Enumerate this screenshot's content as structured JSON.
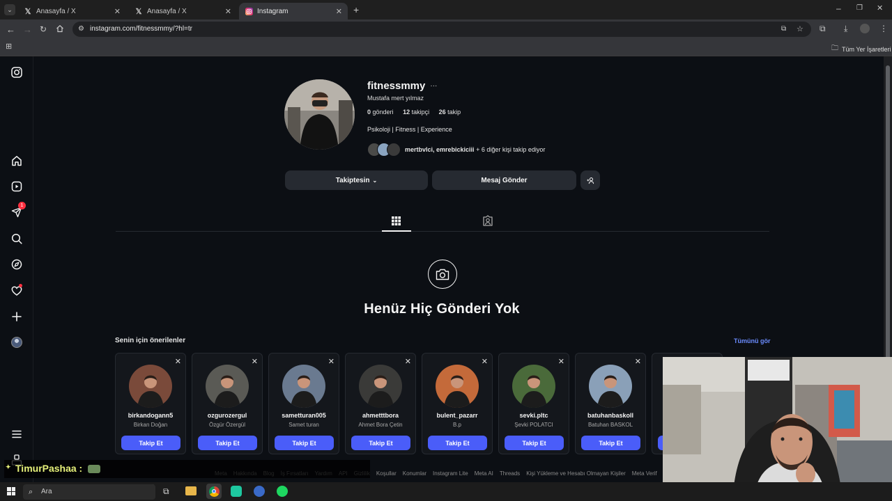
{
  "browser": {
    "tabs": [
      {
        "title": "Anasayfa / X",
        "icon": "x-logo-icon"
      },
      {
        "title": "Anasayfa / X",
        "icon": "x-logo-icon"
      },
      {
        "title": "Instagram",
        "icon": "instagram-icon"
      }
    ],
    "url": "instagram.com/fitnessmmy/?hl=tr",
    "bookmarks_label": "Tüm Yer İşaretleri"
  },
  "sidebar": {
    "notification_count": "1"
  },
  "profile": {
    "username": "fitnessmmy",
    "more": "···",
    "full_name": "Mustafa mert yılmaz",
    "stats": {
      "posts_count": "0",
      "posts_label": "gönderi",
      "followers_count": "12",
      "followers_label": "takipçi",
      "following_count": "26",
      "following_label": "takip"
    },
    "bio": "Psikoloji | Fitness | Experience",
    "followed_by_names": "mertbvlci, emrebickiciii",
    "followed_by_rest": " + 6 diğer kişi takip ediyor",
    "buttons": {
      "following": "Takiptesin",
      "message": "Mesaj Gönder"
    }
  },
  "empty_state": {
    "title": "Henüz Hiç Gönderi Yok"
  },
  "suggestions": {
    "title": "Senin için önerilenler",
    "see_all": "Tümünü gör",
    "follow_label": "Takip Et",
    "items": [
      {
        "username": "birkandogann5",
        "name": "Birkan Doğan",
        "bg": "#7a4a3a"
      },
      {
        "username": "ozgurozergul",
        "name": "Özgür Özergül",
        "bg": "#5a5a55"
      },
      {
        "username": "sametturan005",
        "name": "Samet turan",
        "bg": "#6a7a90"
      },
      {
        "username": "ahmetttbora",
        "name": "Ahmet Bora Çetin",
        "bg": "#3a3a38"
      },
      {
        "username": "bulent_pazarr",
        "name": "B.p",
        "bg": "#c46a3a"
      },
      {
        "username": "sevki.pltc",
        "name": "Şevki POLATCI",
        "bg": "#4a6a3a"
      },
      {
        "username": "batuhanbaskoll",
        "name": "Batuhan BASKOL",
        "bg": "#8aa0b8"
      }
    ]
  },
  "footer": {
    "links": [
      "Meta",
      "Hakkında",
      "Blog",
      "İş Fırsatları",
      "Yardım",
      "API",
      "Gizlilik",
      "Koşullar",
      "Konumlar",
      "Instagram Lite",
      "Meta AI",
      "Threads",
      "Kişi Yükleme ve Hesabı Olmayan Kişiler",
      "Meta Verif"
    ]
  },
  "stream_overlay": {
    "chat_name": "TimurPashaa :"
  },
  "taskbar": {
    "search_placeholder": "Ara"
  }
}
